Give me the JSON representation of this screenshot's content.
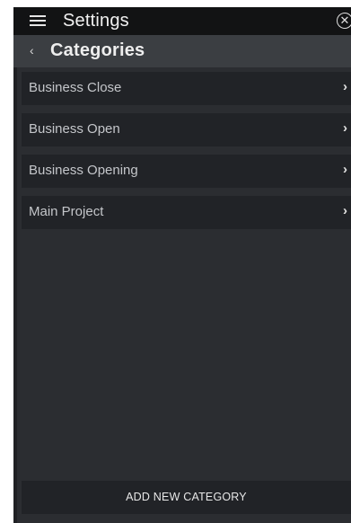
{
  "header": {
    "title": "Settings",
    "menu_icon": "hamburger-menu-icon",
    "close_icon": "close-circle-icon",
    "close_glyph": "✕"
  },
  "subheader": {
    "back_icon": "chevron-left-icon",
    "back_glyph": "‹",
    "title": "Categories"
  },
  "categories": [
    {
      "label": "Business Close",
      "chevron": "›"
    },
    {
      "label": "Business Open",
      "chevron": "›"
    },
    {
      "label": "Business Opening",
      "chevron": "›"
    },
    {
      "label": "Main Project",
      "chevron": "›"
    }
  ],
  "footer": {
    "add_label": "ADD NEW CATEGORY"
  },
  "colors": {
    "topbar": "#121314",
    "subheader": "#3b3e42",
    "background": "#2b2d31",
    "item": "#212327",
    "text": "#c4c6ca"
  }
}
